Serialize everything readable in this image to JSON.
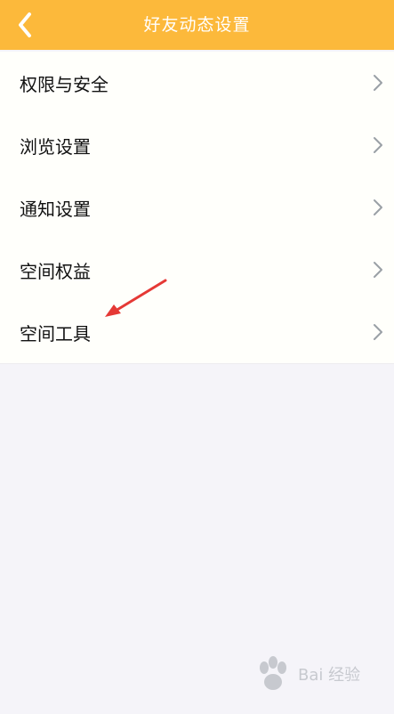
{
  "header": {
    "title": "好友动态设置",
    "back_icon": "back-chevron-icon",
    "background": "#fcb93b"
  },
  "menu": {
    "items": [
      {
        "label": "权限与安全"
      },
      {
        "label": "浏览设置"
      },
      {
        "label": "通知设置"
      },
      {
        "label": "空间权益"
      },
      {
        "label": "空间工具"
      }
    ],
    "chevron_icon": "chevron-right-icon"
  },
  "annotation": {
    "type": "red-arrow",
    "color": "#e53935",
    "points_to": "空间工具"
  },
  "watermark": {
    "text": "Bai 经验"
  }
}
